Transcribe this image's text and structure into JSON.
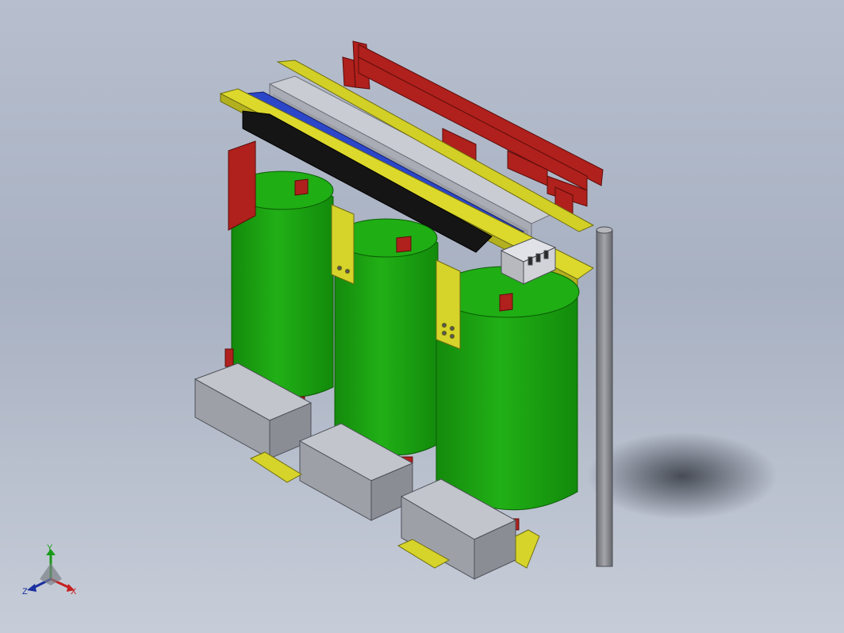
{
  "view": {
    "background_top": "#b7bfce",
    "background_bottom": "#c7cdd8"
  },
  "model": {
    "name": "three-phase-dry-type-transformer",
    "colors": {
      "coil_green": "#1ea514",
      "coil_dark": "#138a0c",
      "clamp_yellow": "#d8d62a",
      "frame_red": "#b0201c",
      "blue_bar": "#2b46c8",
      "black_bar": "#151515",
      "core_grey": "#b4b7bf",
      "base_grey": "#9ea0a8",
      "pole_grey": "#888a90"
    }
  },
  "triad": {
    "x_label": "X",
    "y_label": "Y",
    "z_label": "Z",
    "x_color": "#c62020",
    "y_color": "#1a9a1a",
    "z_color": "#1a2fa0"
  }
}
